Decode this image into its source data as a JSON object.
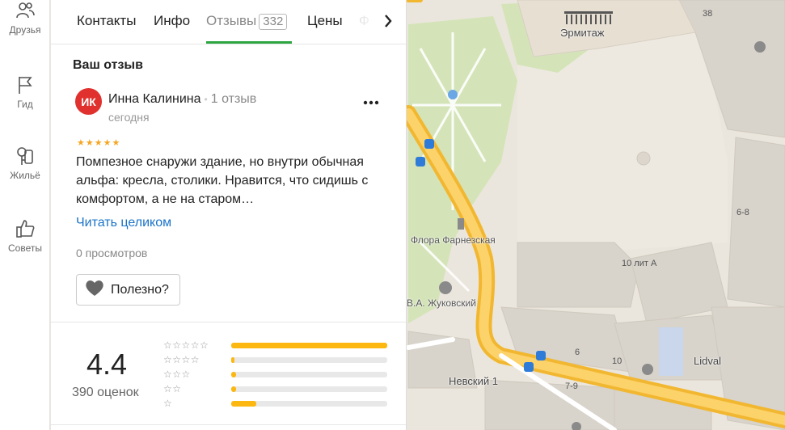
{
  "rail": {
    "items": [
      {
        "label": "Друзья",
        "icon": "friends-icon"
      },
      {
        "label": "Гид",
        "icon": "flag-icon"
      },
      {
        "label": "Жильё",
        "icon": "housing-icon"
      },
      {
        "label": "Советы",
        "icon": "thumbs-up-icon"
      }
    ]
  },
  "tabs": {
    "items": [
      "Контакты",
      "Инфо",
      "Отзывы",
      "Цены",
      "Ф"
    ],
    "active": "Отзывы",
    "reviews_count": "332",
    "accent_color": "#2da642"
  },
  "review": {
    "section_title": "Ваш отзыв",
    "avatar_initials": "ИК",
    "avatar_color": "#e0312e",
    "author": "Инна Калинина",
    "author_reviews": "1 отзыв",
    "date": "сегодня",
    "rating": 5,
    "stars_text": "★★★★★",
    "text": "Помпезное снаружи здание, но внутри обычная альфа: кресла, столики. Нравится, что сидишь с комфортом, а не на старом…",
    "read_more": "Читать целиком",
    "views": "0 просмотров",
    "useful_label": "Полезно?"
  },
  "rating": {
    "average": "4.4",
    "count": "390 оценок",
    "distribution": [
      {
        "stars": "★★★★★",
        "fraction": 1.0
      },
      {
        "stars": "★★★★",
        "fraction": 0.02
      },
      {
        "stars": "★★★",
        "fraction": 0.03
      },
      {
        "stars": "★★",
        "fraction": 0.03
      },
      {
        "stars": "★",
        "fraction": 0.16
      }
    ],
    "bar_color": "#fcb711"
  },
  "map": {
    "labels": {
      "hermitage": "Эрмитаж",
      "flora": "Флора Фарнезская",
      "zhukovsky": "В.А. Жуковский",
      "nevsky": "Невский 1",
      "lidval": "Lidval",
      "bldg_10a": "10 лит А",
      "n38": "38",
      "n68": "6-8",
      "n6": "6",
      "n10": "10",
      "n79": "7-9"
    }
  }
}
